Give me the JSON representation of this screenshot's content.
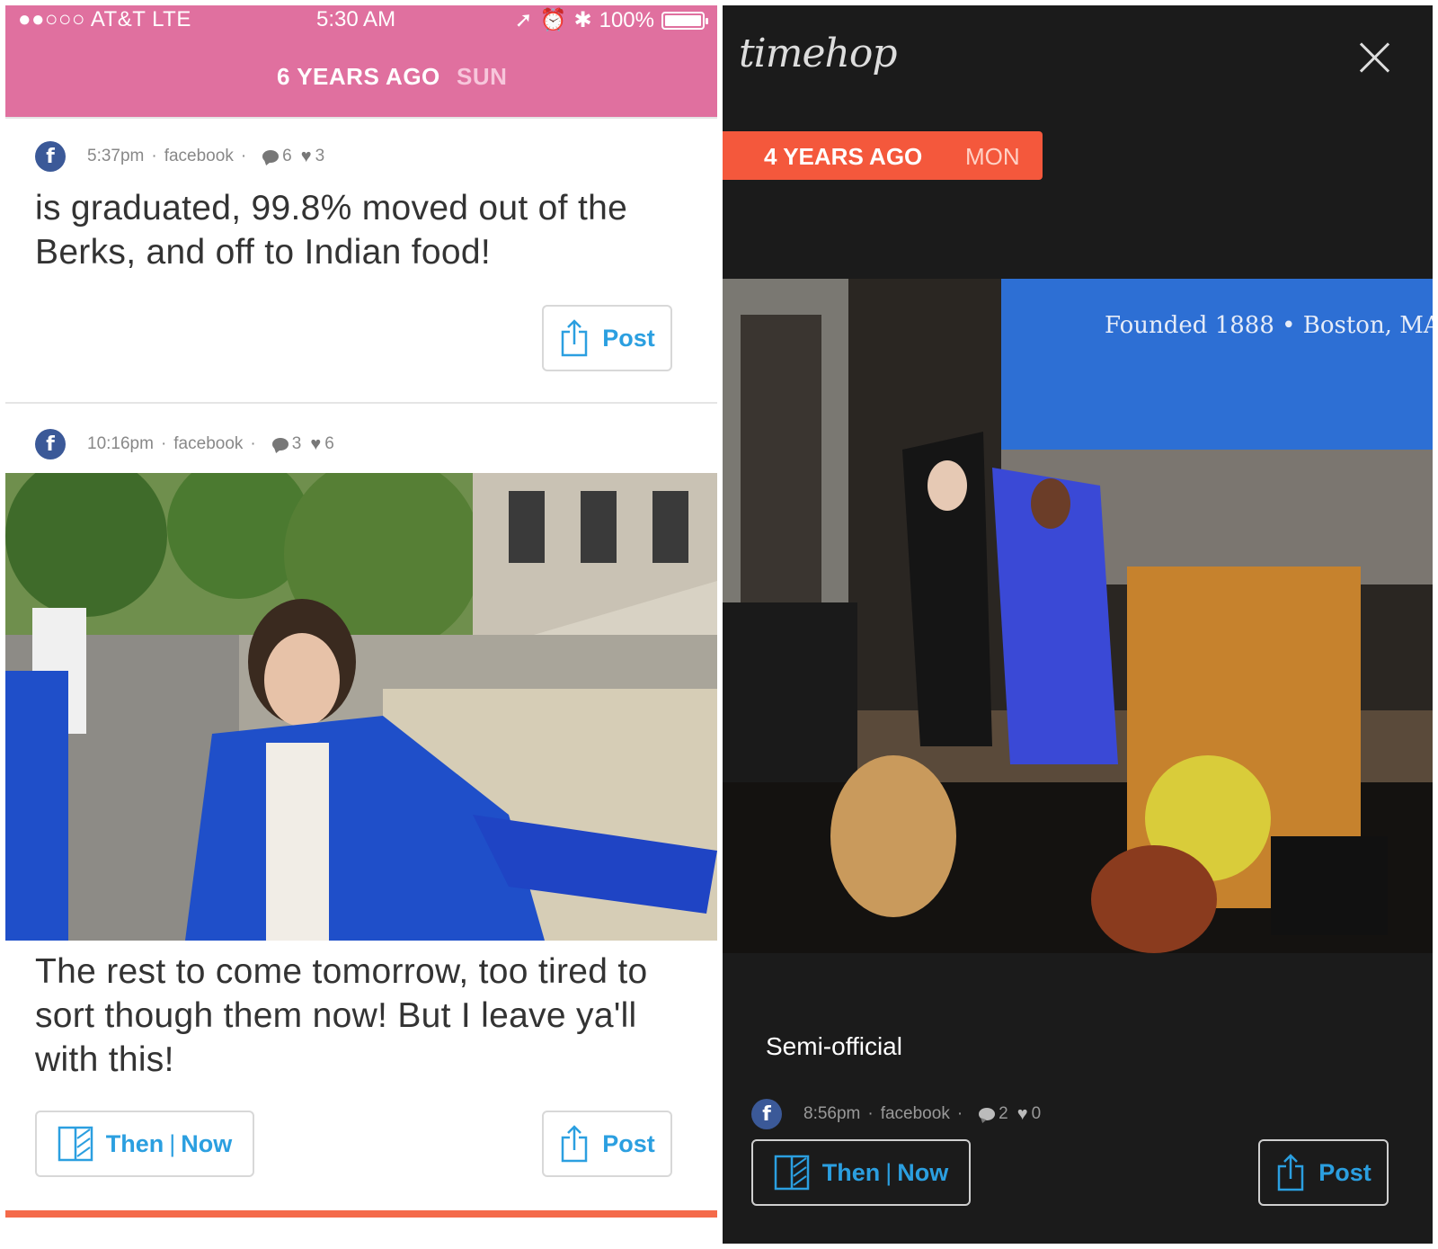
{
  "statusbar": {
    "carrier": "●●○○○ AT&T  LTE",
    "time": "5:30 AM",
    "battery": "100%"
  },
  "left_header": {
    "years_ago": "6 YEARS AGO",
    "day": "SUN"
  },
  "posts": [
    {
      "time": "5:37pm",
      "source": "facebook",
      "comments": "6",
      "likes": "3",
      "text": "is graduated, 99.8% moved out of the Berks, and off to Indian food!",
      "post_label": "Post"
    },
    {
      "time": "10:16pm",
      "source": "facebook",
      "comments": "3",
      "likes": "6",
      "text": "The rest to come tomorrow, too tired to sort though them now! But I leave ya'll with this!",
      "then_label": "Then",
      "now_label": "Now",
      "post_label": "Post"
    }
  ],
  "right": {
    "logo": "timehop",
    "years_ago": "4 YEARS AGO",
    "day": "MON",
    "banner_text": "Founded 1888 • Boston, MA",
    "caption": "Semi-official",
    "time": "8:56pm",
    "source": "facebook",
    "comments": "2",
    "likes": "0",
    "then_label": "Then",
    "now_label": "Now",
    "post_label": "Post"
  },
  "colors": {
    "pink": "#e0709f",
    "orange": "#f4583c",
    "blue": "#2b9fe0",
    "facebook": "#3b5998"
  }
}
